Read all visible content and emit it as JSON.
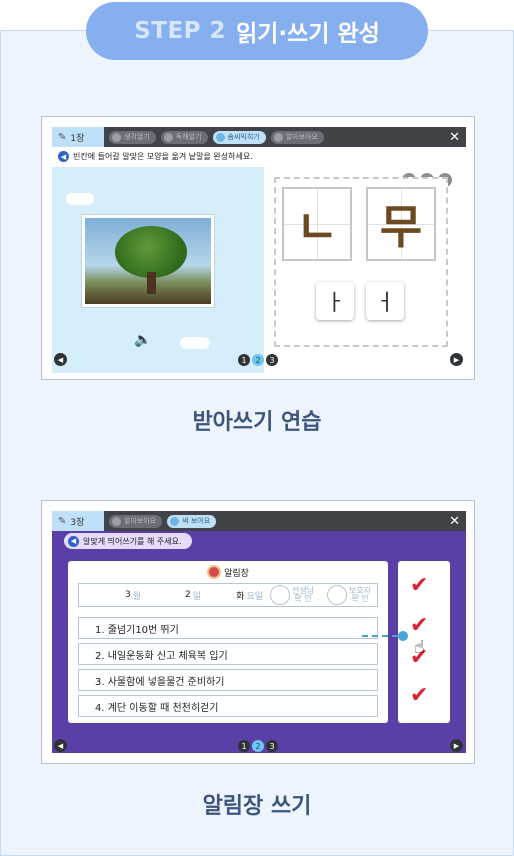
{
  "step_pill": {
    "step": "STEP 2",
    "title": "읽기·쓰기 완성"
  },
  "captions": [
    "받아쓰기 연습",
    "알림장 쓰기"
  ],
  "shot1": {
    "chapter": "1장",
    "tabs": [
      "생각열기",
      "독해알기",
      "솜씨익히기",
      "알아보아요"
    ],
    "active_tab": 2,
    "instruction": "빈칸에 들어갈 알맞은 모양을 옮겨 낱말을 완성하세요.",
    "cards": [
      "ㄴ",
      "무"
    ],
    "tiles": [
      "ㅏ",
      "ㅓ"
    ],
    "pages": [
      "1",
      "2",
      "3"
    ],
    "current_page": "2",
    "icons": [
      "pencil-icon",
      "speaker-icon",
      "close-icon",
      "left-arrow-icon",
      "right-arrow-icon"
    ]
  },
  "shot2": {
    "chapter": "3장",
    "tabs": [
      "알아보아요",
      "써 보아요"
    ],
    "active_tab": 1,
    "instruction": "알맞게 띄어쓰기를 해 주세요.",
    "notice_title": "알림장",
    "date": {
      "month": "3",
      "month_unit": "월",
      "day": "2",
      "day_unit": "일",
      "weekday": "화",
      "weekday_unit": "요일"
    },
    "seals": [
      "선생님\n확 인",
      "보호자\n확 인"
    ],
    "tasks": [
      "1. 줄넘기10번 뛰기",
      "2. 내일운동화 신고 체육복 입기",
      "3. 사물함에 넣을물건 준비하기",
      "4. 계단 이동할 때 천천히걷기"
    ],
    "pages": [
      "1",
      "2",
      "3"
    ],
    "current_page": "2",
    "check_mark": "✔"
  }
}
